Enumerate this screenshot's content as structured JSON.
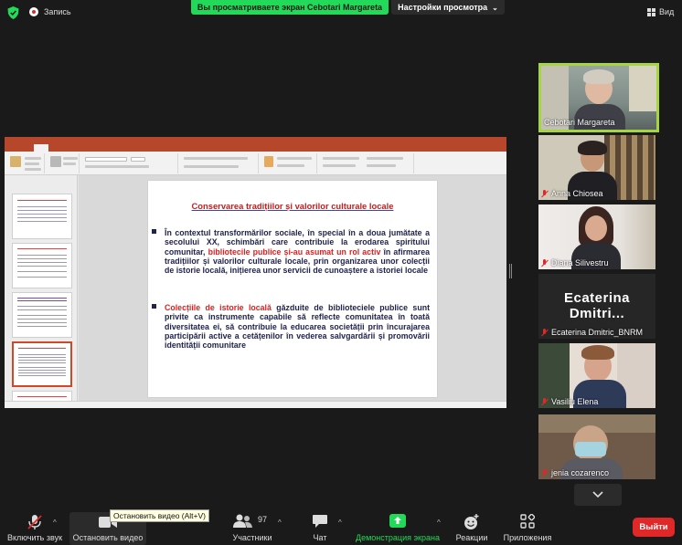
{
  "topbar": {
    "recording_label": "Запись",
    "viewing_banner": "Вы просматриваете экран Cebotari Margareta",
    "view_options_label": "Настройки просмотра",
    "view_button_label": "Вид"
  },
  "share": {
    "slide": {
      "title": "Conservarea tradițiilor și valorilor culturale locale",
      "bullets": [
        {
          "text_before": "În contextul transformărilor sociale, în special în a doua jumătate a secolului XX, schimbări care contribuie la erodarea spiritului comunitar, ",
          "highlight": "bibliotecile publice și-au asumat un rol activ",
          "text_after": " în afirmarea tradițiilor și valorilor culturale locale, prin organizarea unor colecții de istorie locală, inițierea unor servicii de cunoaștere a istoriei locale"
        },
        {
          "text_before": "",
          "highlight": "Colecțiile de istorie locală",
          "text_after": " găzduite de biblioteciele publice sunt privite ca instrumente capabile să reflecte comunitatea în toată diversitatea ei, să contribuie la educarea societății prin încurajarea participării active a cetățenilor în vederea salvgardării și promovării identității comunitare"
        }
      ]
    }
  },
  "gallery": {
    "participants": [
      {
        "name": "Cebotari Margareta",
        "muted": false,
        "active": true
      },
      {
        "name": "Anna Chiosea",
        "muted": true
      },
      {
        "name": "Diana Silivestru",
        "muted": true
      },
      {
        "name": "Ecaterina Dmitric_BNRM",
        "display_text": "Ecaterina Dmitri...",
        "muted": true
      },
      {
        "name": "Vasiliu Elena",
        "muted": true
      },
      {
        "name": "jenia cozarenco",
        "muted": true
      }
    ]
  },
  "toolbar": {
    "unmute_label": "Включить звук",
    "stop_video_label": "Остановить видео",
    "stop_video_tooltip": "Остановить видео (Alt+V)",
    "participants_label": "Участники",
    "participants_count": "97",
    "chat_label": "Чат",
    "share_label": "Демонстрация экрана",
    "reactions_label": "Реакции",
    "apps_label": "Приложения",
    "leave_label": "Выйти"
  },
  "colors": {
    "share_banner": "#23d959",
    "active_speaker_border": "#a5d63f",
    "leave_button": "#e02828",
    "slide_title": "#c02020",
    "slide_text": "#20244d"
  }
}
